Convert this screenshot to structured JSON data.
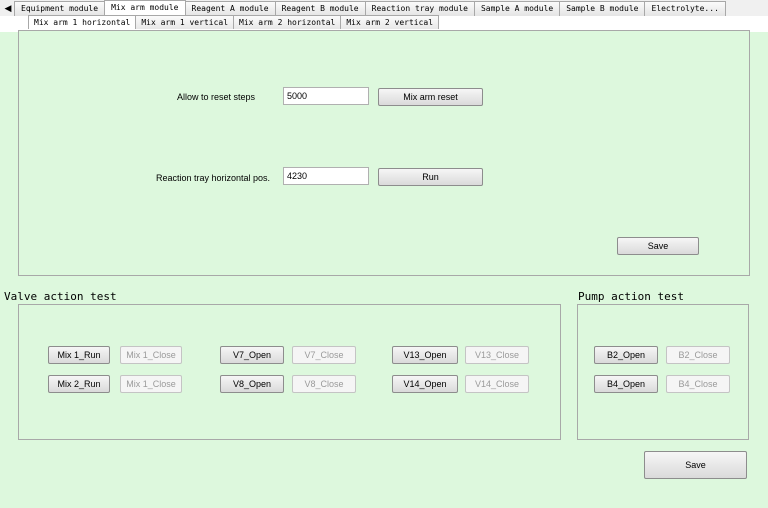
{
  "top_tabs": [
    "Equipment module",
    "Mix arm module",
    "Reagent A module",
    "Reagent B module",
    "Reaction tray module",
    "Sample A module",
    "Sample B module",
    "Electrolyte..."
  ],
  "sub_tabs": [
    "Mix arm 1 horizontal",
    "Mix arm 1 vertical",
    "Mix arm 2 horizontal",
    "Mix arm 2 vertical"
  ],
  "reset": {
    "label": "Allow to reset steps",
    "value": "5000",
    "button": "Mix arm reset"
  },
  "tray": {
    "label": "Reaction tray horizontal pos.",
    "value": "4230",
    "button": "Run"
  },
  "panel_save": "Save",
  "valve": {
    "title": "Valve action test",
    "row1": [
      "Mix 1_Run",
      "Mix 1_Close",
      "V7_Open",
      "V7_Close",
      "V13_Open",
      "V13_Close"
    ],
    "row2": [
      "Mix 2_Run",
      "Mix 1_Close",
      "V8_Open",
      "V8_Close",
      "V14_Open",
      "V14_Close"
    ]
  },
  "pump": {
    "title": "Pump action test",
    "row1": [
      "B2_Open",
      "B2_Close"
    ],
    "row2": [
      "B4_Open",
      "B4_Close"
    ]
  },
  "bottom_save": "Save"
}
